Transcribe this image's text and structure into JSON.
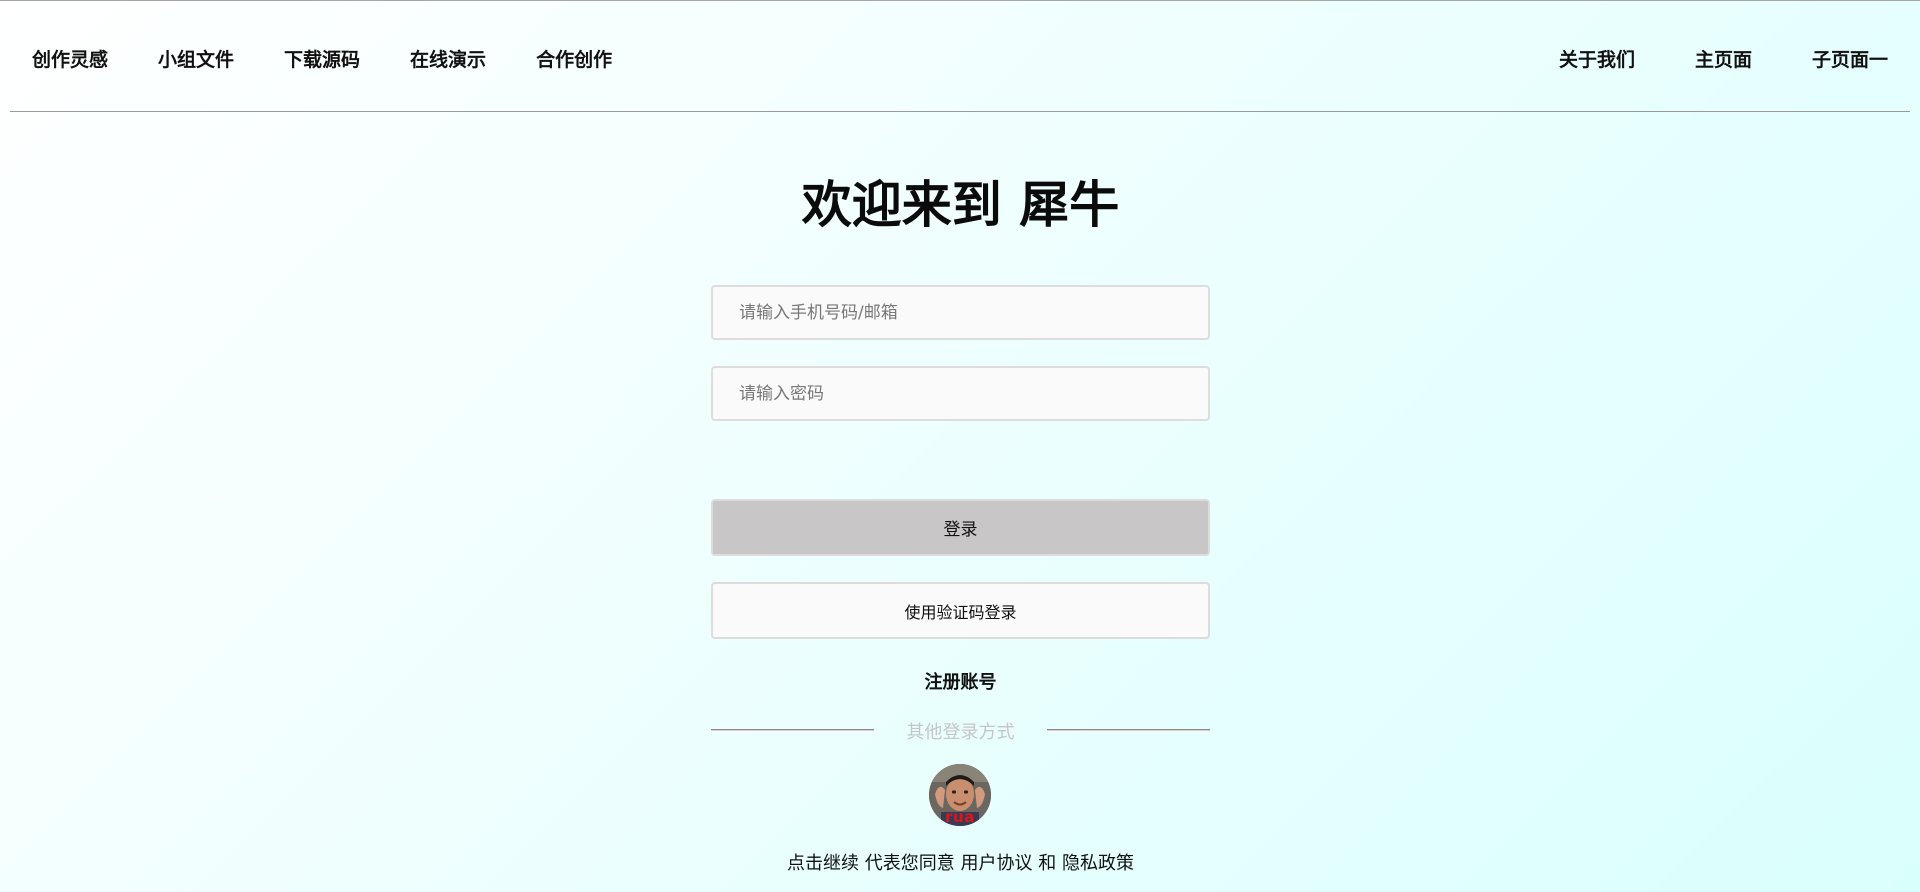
{
  "nav": {
    "left": [
      "创作灵感",
      "小组文件",
      "下载源码",
      "在线演示",
      "合作创作"
    ],
    "right": [
      "关于我们",
      "主页面",
      "子页面一"
    ]
  },
  "login": {
    "title": "欢迎来到 犀牛",
    "phone_placeholder": "请输入手机号码/邮箱",
    "password_placeholder": "请输入密码",
    "login_button": "登录",
    "code_login_button": "使用验证码登录",
    "register_link": "注册账号",
    "other_methods": "其他登录方式",
    "avatar_caption": "rua",
    "agreement": {
      "prefix": "点击继续 代表您同意 ",
      "user_agreement": "用户协议",
      "conjunction": " 和 ",
      "privacy_policy": "隐私政策"
    }
  },
  "colors": {
    "login_button_bg": "#c8c6c7",
    "field_bg": "#fafafa",
    "divider_text": "#c6c6c6",
    "avatar_caption": "#e0141a"
  }
}
